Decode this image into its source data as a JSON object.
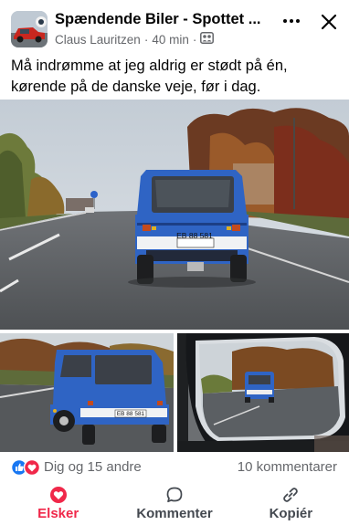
{
  "post": {
    "group_name": "Spændende Biler - Spottet ...",
    "author": "Claus Lauritzen",
    "separator": "·",
    "time": "40 min",
    "separator2": "·",
    "audience_icon": "group-icon",
    "text": "Må indrømme at jeg aldrig er stødt på én, kørende på de danske veje, før i dag."
  },
  "photos": {
    "main_plate": "EB 88 581",
    "left_plate": "EB 88 581"
  },
  "reactions": {
    "icons": [
      "like-icon",
      "love-icon"
    ],
    "summary": "Dig og 15 andre",
    "comments": "10 kommentarer"
  },
  "actions": {
    "love_label": "Elsker",
    "comment_label": "Kommenter",
    "copy_label": "Kopiér"
  },
  "colors": {
    "love": "#f0284a",
    "like": "#1877f2",
    "car_blue": "#2f64c4"
  }
}
